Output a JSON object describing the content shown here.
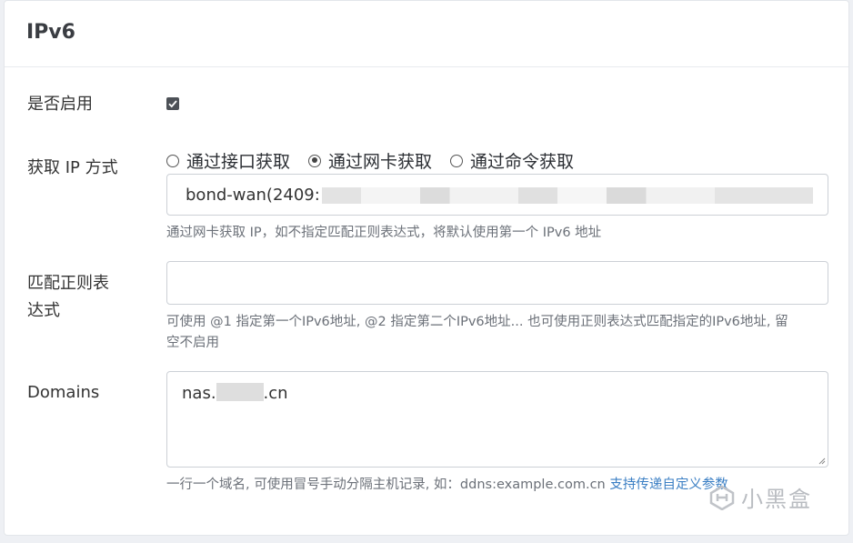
{
  "card": {
    "title": "IPv6"
  },
  "enable": {
    "label": "是否启用",
    "checked": true
  },
  "ip_method": {
    "label": "获取 IP 方式",
    "options": [
      {
        "label": "通过接口获取",
        "checked": false
      },
      {
        "label": "通过网卡获取",
        "checked": true
      },
      {
        "label": "通过命令获取",
        "checked": false
      }
    ],
    "selected_value": "bond-wan(2409:",
    "help": "通过网卡获取 IP，如不指定匹配正则表达式，将默认使用第一个 IPv6 地址"
  },
  "regex": {
    "label_line1": "匹配正则表",
    "label_line2": "达式",
    "value": "",
    "help_line1": "可使用 @1 指定第一个IPv6地址, @2 指定第二个IPv6地址... 也可使用正则表达式匹配指定的IPv6地址, 留",
    "help_line2": "空不启用"
  },
  "domains": {
    "label": "Domains",
    "value_prefix": "nas.",
    "value_suffix": ".cn",
    "help": "一行一个域名, 可使用冒号手动分隔主机记录, 如：ddns:example.com.cn ",
    "help_link": "支持传递自定义参数"
  },
  "watermark": {
    "text": "小黑盒"
  },
  "colors": {
    "link": "#3b7fc4",
    "checkbox": "#4d5157"
  }
}
